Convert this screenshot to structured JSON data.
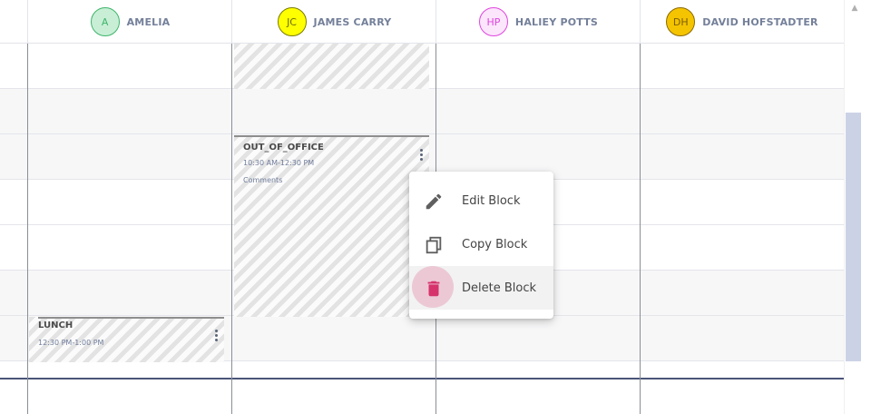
{
  "columns": [
    {
      "initials": "A",
      "name": "AMELIA",
      "avatar_fill": "#c8efd6",
      "avatar_border": "#3fb46a",
      "avatar_text": "#3fb46a"
    },
    {
      "initials": "JC",
      "name": "JAMES CARRY",
      "avatar_fill": "#ffff00",
      "avatar_border": "#7a7a00",
      "avatar_text": "#6b6b00"
    },
    {
      "initials": "HP",
      "name": "HALIEY POTTS",
      "avatar_fill": "#fbe6fb",
      "avatar_border": "#e045e0",
      "avatar_text": "#e045e0"
    },
    {
      "initials": "DH",
      "name": "DAVID HOFSTADTER",
      "avatar_fill": "#f5c400",
      "avatar_border": "#8a6a00",
      "avatar_text": "#7a5d00"
    }
  ],
  "blocks": [
    {
      "title": "",
      "time": "",
      "comment": ""
    },
    {
      "title": "OUT_OF_OFFICE",
      "time": "10:30 AM-12:30 PM",
      "comment": "Comments"
    },
    {
      "title": "LUNCH",
      "time": "12:30 PM-1:00 PM",
      "comment": ""
    }
  ],
  "context_menu": {
    "items": [
      {
        "label": "Edit Block",
        "icon": "pencil-icon"
      },
      {
        "label": "Copy Block",
        "icon": "copy-icon"
      },
      {
        "label": "Delete Block",
        "icon": "trash-icon",
        "color": "#d6336c"
      }
    ]
  },
  "scrollbar": {
    "up_arrow": "▲"
  }
}
